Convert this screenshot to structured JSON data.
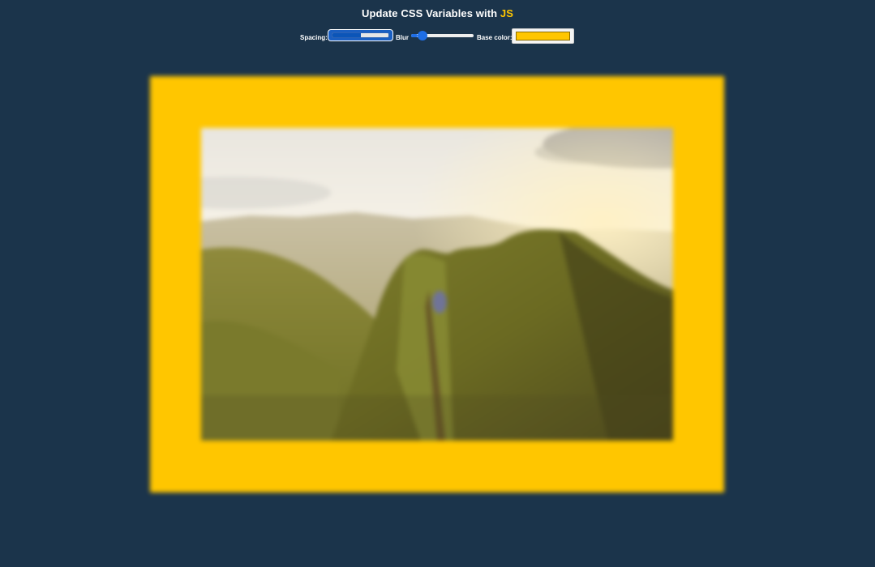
{
  "page": {
    "title_main": "Update CSS Variables with ",
    "title_highlight": "JS"
  },
  "controls": {
    "spacing": {
      "label": "Spacing:",
      "value": 0.5
    },
    "blur": {
      "label": "Blur",
      "value": 0.1
    },
    "base_color": {
      "label": "Base color:",
      "value": "#ffc600"
    }
  },
  "colors": {
    "background": "#1b344b",
    "highlight": "#ffc600"
  },
  "image": {
    "alt": "",
    "icon": "mountain-ridge-photo"
  }
}
